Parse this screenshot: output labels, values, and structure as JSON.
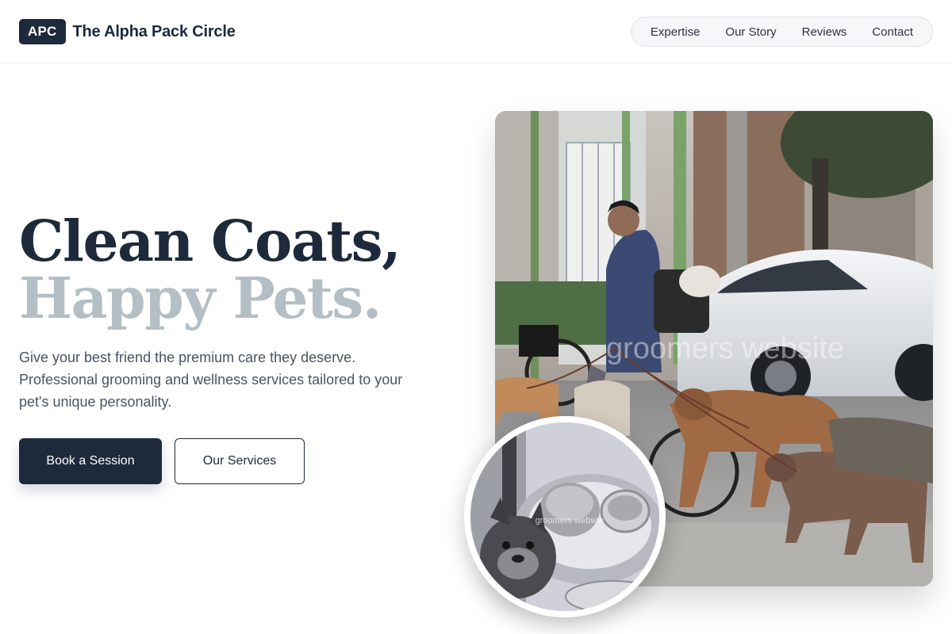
{
  "brand": {
    "badge": "APC",
    "name": "The Alpha Pack Circle"
  },
  "nav": {
    "items": [
      "Expertise",
      "Our Story",
      "Reviews",
      "Contact"
    ]
  },
  "hero": {
    "headline_line1": "Clean Coats,",
    "headline_line2": "Happy Pets.",
    "subtext": "Give your best friend the premium care they deserve. Professional grooming and wellness services tailored to your pet's unique personality.",
    "primary_button": "Book a Session",
    "secondary_button": "Our Services"
  },
  "images": {
    "main_watermark": "groomers website",
    "circle_watermark": "groomers website"
  },
  "colors": {
    "primary": "#1e293b",
    "muted_headline": "#b4bfc5",
    "body_text": "#4a5463"
  }
}
